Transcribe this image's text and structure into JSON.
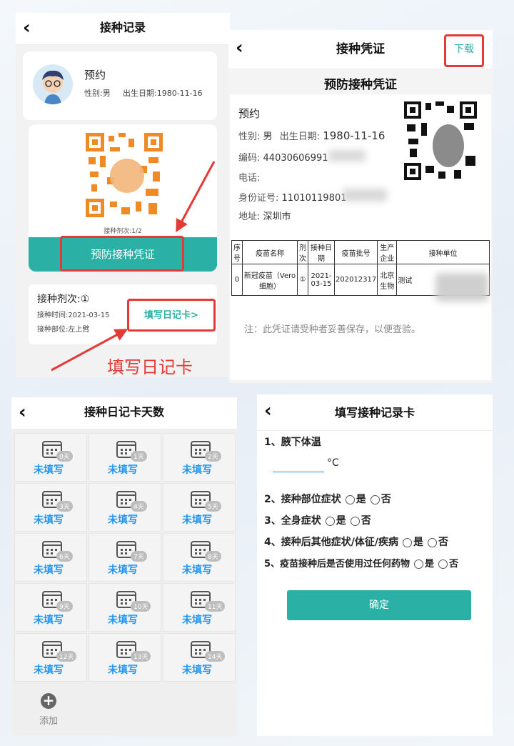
{
  "record": {
    "title": "接种记录",
    "name": "预约",
    "gender": "性别:男",
    "birth": "出生日期:1980-11-16",
    "dose_progress": "接种剂次:1/2",
    "cert_button": "预防接种凭证",
    "dose_label": "接种剂次:①",
    "dose_time": "接种时间:2021-03-15",
    "dose_site": "接种部位:左上臂",
    "diary_link": "填写日记卡>",
    "annotation": "填写日记卡"
  },
  "certificate": {
    "title": "接种凭证",
    "download": "下载",
    "heading": "预防接种凭证",
    "name": "预约",
    "gender_label": "性别:",
    "gender": "男",
    "birth_label": "出生日期:",
    "birth": "1980-11-16",
    "code_label": "编码:",
    "code": "44030606991",
    "phone_label": "电话:",
    "id_label": "身份证号:",
    "id_value": "11010119801",
    "address_label": "地址:",
    "address": "深圳市",
    "table_headers": [
      "序号",
      "疫苗名称",
      "剂次",
      "接种日期",
      "疫苗批号",
      "生产企业",
      "接种单位"
    ],
    "table_row": [
      "0",
      "新冠疫苗（Vero细胞）",
      "①",
      "2021-03-15",
      "202012317",
      "北京生物",
      "测试"
    ],
    "note": "注：此凭证请受种者妥善保存，以便查验。"
  },
  "diary": {
    "title": "接种日记卡天数",
    "days": [
      "0天",
      "1天",
      "2天",
      "3天",
      "4天",
      "5天",
      "6天",
      "7天",
      "8天",
      "9天",
      "10天",
      "11天",
      "12天",
      "13天",
      "14天"
    ],
    "status": "未填写",
    "add_label": "添加"
  },
  "form": {
    "title": "填写接种记录卡",
    "q1": "1、腋下体温",
    "unit": "°C",
    "q2": "2、接种部位症状",
    "q3": "3、全身症状",
    "q4": "4、接种后其他症状/体征/疾病",
    "q5": "5、疫苗接种后是否使用过任何药物",
    "yes": "是",
    "no": "否",
    "confirm": "确定"
  },
  "colors": {
    "accent": "#2bb0a6",
    "annotation_red": "#e53935",
    "status_blue": "#2196f3"
  }
}
